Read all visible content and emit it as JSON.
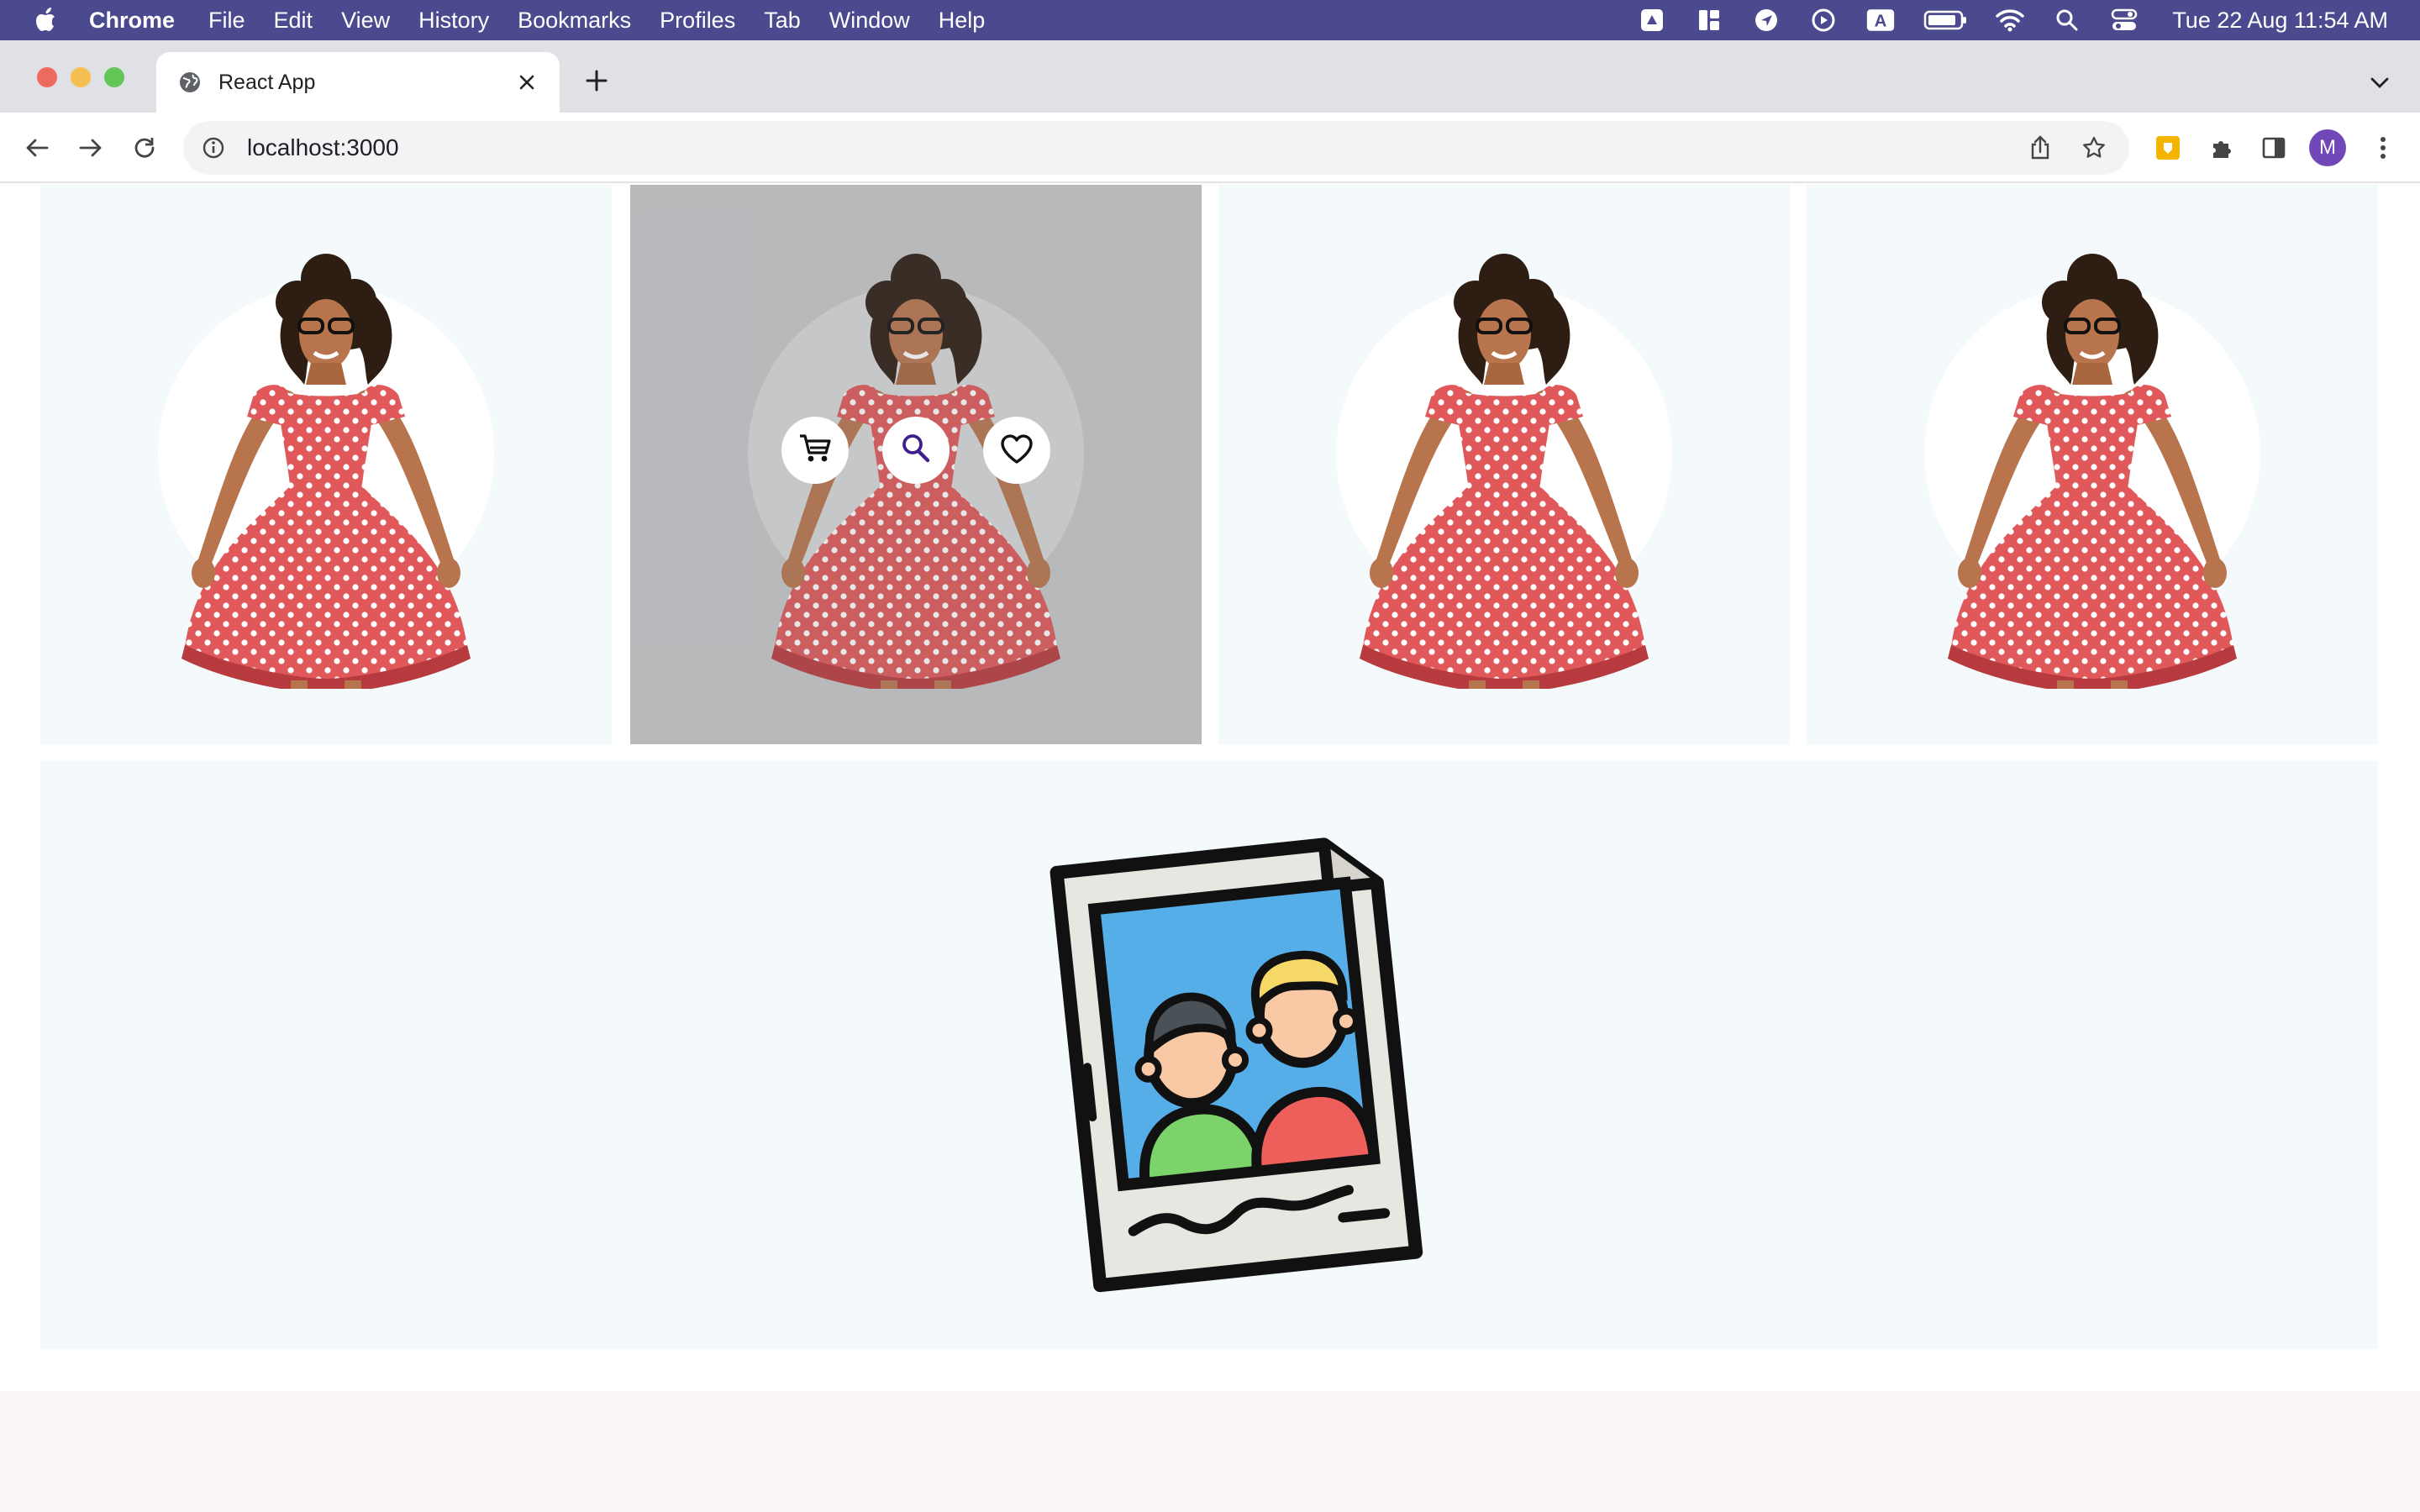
{
  "menubar": {
    "app_name": "Chrome",
    "items": [
      "File",
      "Edit",
      "View",
      "History",
      "Bookmarks",
      "Profiles",
      "Tab",
      "Window",
      "Help"
    ],
    "clock": "Tue 22 Aug  11:54 AM",
    "tray_icons": [
      "drive-icon",
      "dashboard-icon",
      "location-icon",
      "play-icon",
      "keyboard-a-icon",
      "battery-icon",
      "wifi-icon",
      "spotlight-search-icon",
      "control-center-icon"
    ],
    "keyboard_letter": "A"
  },
  "tab": {
    "title": "React App"
  },
  "toolbar": {
    "url": "localhost:3000",
    "avatar_letter": "M"
  },
  "products": [
    {
      "name": "red-polka-dot-dress",
      "hovered": false
    },
    {
      "name": "red-polka-dot-dress",
      "hovered": true
    },
    {
      "name": "red-polka-dot-dress",
      "hovered": false
    },
    {
      "name": "red-polka-dot-dress",
      "hovered": false
    }
  ],
  "product_actions": [
    "cart-icon",
    "search-icon",
    "heart-icon"
  ],
  "colors": {
    "menubar": "#4b4a8f",
    "card_bg": "#f4f9fc",
    "hover_bg": "#c5c7c9",
    "dress_red": "#e0585a",
    "accent_purple": "#3f1f8c"
  }
}
